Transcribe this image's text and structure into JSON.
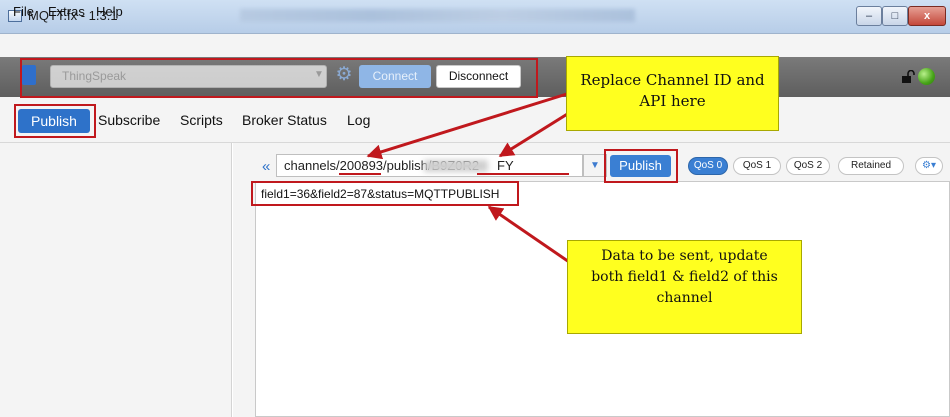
{
  "window": {
    "title": "MQTT.fx - 1.3.1",
    "controls": {
      "minimize": "–",
      "maximize": "□",
      "close": "x"
    }
  },
  "menu": {
    "items": [
      "File",
      "Extras",
      "Help"
    ]
  },
  "connection": {
    "profile": "ThingSpeak",
    "connect_label": "Connect",
    "disconnect_label": "Disconnect",
    "status_color": "#46a317"
  },
  "tabs": {
    "items": [
      "Publish",
      "Subscribe",
      "Scripts",
      "Broker Status",
      "Log"
    ],
    "active": "Publish",
    "active_color": "#2e72c9"
  },
  "publish": {
    "topic_part1": "channels/200893/publish/B9Z0R2",
    "topic_part2": "FY",
    "button_label": "Publish",
    "qos": [
      "QoS 0",
      "QoS 1",
      "QoS 2"
    ],
    "qos_selected": "QoS 0",
    "retained_label": "Retained",
    "payload": "field1=36&field2=87&status=MQTTPUBLISH"
  },
  "annotations": {
    "topic_note_line1": "Replace Channel ID and",
    "topic_note_line2": "API here",
    "payload_note_line1": "Data to be sent, update",
    "payload_note_line2": "both field1 & field2 of this",
    "payload_note_line3": "channel",
    "highlight_color": "#ffff1f",
    "outline_color": "#c0181d"
  },
  "icons": {
    "app": "app-icon",
    "settings": "gear-icon",
    "lock": "unlocked-icon",
    "status": "status-led",
    "collapse": "double-chevron-left-icon",
    "dropdown": "chevron-down-icon",
    "options": "gear-dropdown-icon"
  }
}
